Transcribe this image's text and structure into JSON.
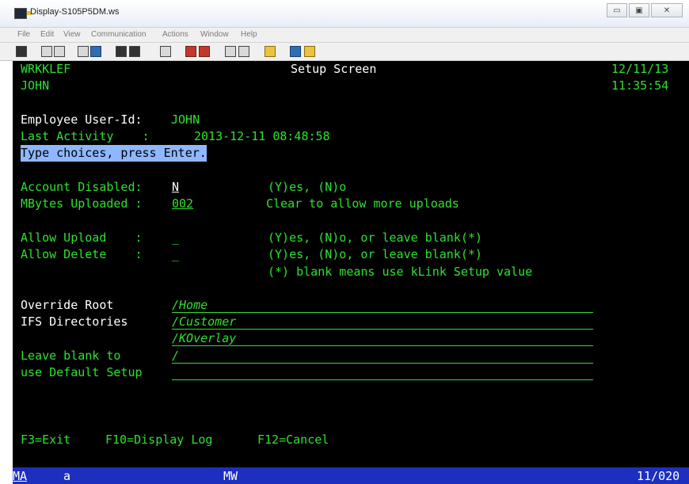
{
  "window": {
    "title": "Display-S105P5DM.ws",
    "minimize": "▭",
    "maximize": "▣",
    "close": "✕"
  },
  "menu": [
    "File",
    "Edit",
    "View",
    "Communication",
    "Actions",
    "Window",
    "Help"
  ],
  "screen": {
    "program": "WRKKLEF",
    "user": "JOHN",
    "title": "Setup Screen",
    "date": "12/11/13",
    "time": "11:35:54",
    "employee_label": "Employee User-Id:",
    "employee_value": "JOHN",
    "last_activity_label": "Last Activity    :",
    "last_activity_value": "2013-12-11 08:48:58",
    "instructions": "Type choices, press Enter.",
    "account_disabled_label": "Account Disabled:",
    "account_disabled_value": "N",
    "account_disabled_hint": "(Y)es, (N)o",
    "mbytes_label": "MBytes Uploaded :",
    "mbytes_value": "002",
    "mbytes_hint": "Clear to allow more uploads",
    "allow_upload_label": "Allow Upload    :",
    "allow_upload_value": "_",
    "allow_upload_hint": "(Y)es, (N)o, or leave blank(*)",
    "allow_delete_label": "Allow Delete    :",
    "allow_delete_value": "_",
    "allow_delete_hint": "(Y)es, (N)o, or leave blank(*)",
    "blank_note": "(*) blank means use kLink Setup value",
    "override_root_label": "Override Root",
    "ifs_dirs_label": "IFS Directories",
    "leave_blank_label": "Leave blank to",
    "default_setup_label": "use Default Setup",
    "directories": [
      "/Home",
      "/Customer",
      "/KOverlay",
      "/",
      ""
    ],
    "fkeys": [
      "F3=Exit",
      "F10=Display Log",
      "F12=Cancel"
    ]
  },
  "status": {
    "ma": "MA",
    "a": "a",
    "mw": "MW",
    "cursor": "11/020"
  }
}
